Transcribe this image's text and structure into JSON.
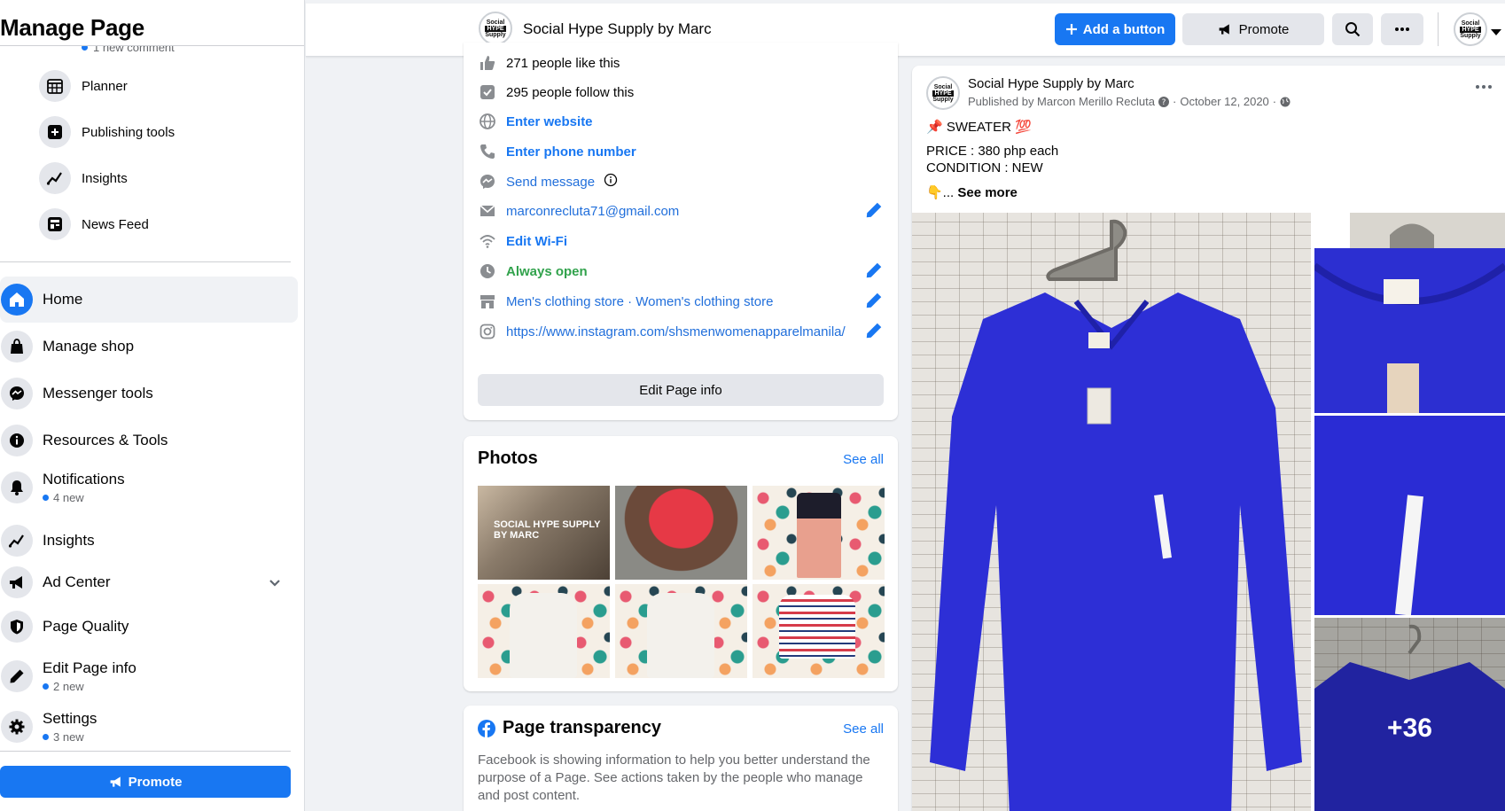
{
  "sidebar": {
    "title": "Manage Page",
    "partial_sub": "1 new comment",
    "tools": [
      {
        "label": "Planner",
        "icon": "calendar-icon"
      },
      {
        "label": "Publishing tools",
        "icon": "publishing-icon"
      },
      {
        "label": "Insights",
        "icon": "insights-icon"
      },
      {
        "label": "News Feed",
        "icon": "news-feed-icon"
      }
    ],
    "nav": [
      {
        "label": "Home",
        "sub": "",
        "icon": "home-icon"
      },
      {
        "label": "Manage shop",
        "sub": "",
        "icon": "shop-bag-icon"
      },
      {
        "label": "Messenger tools",
        "sub": "",
        "icon": "messenger-icon"
      },
      {
        "label": "Resources & Tools",
        "sub": "",
        "icon": "info-icon"
      },
      {
        "label": "Notifications",
        "sub": "4 new",
        "icon": "bell-icon"
      },
      {
        "label": "Insights",
        "sub": "",
        "icon": "insights-icon"
      },
      {
        "label": "Ad Center",
        "sub": "",
        "icon": "megaphone-icon"
      },
      {
        "label": "Page Quality",
        "sub": "",
        "icon": "shield-icon"
      },
      {
        "label": "Edit Page info",
        "sub": "2 new",
        "icon": "pencil-icon"
      },
      {
        "label": "Settings",
        "sub": "3 new",
        "icon": "gear-icon"
      }
    ],
    "promote_label": "Promote"
  },
  "topbar": {
    "page_name": "Social Hype Supply by Marc",
    "add_button_label": "Add a button",
    "promote_label": "Promote"
  },
  "logo": {
    "l1": "Social",
    "l2": "HYPE",
    "l3": "Supply"
  },
  "about": {
    "likes": "271 people like this",
    "follows": "295 people follow this",
    "website": "Enter website",
    "phone": "Enter phone number",
    "message": "Send message",
    "email": "marconrecluta71@gmail.com",
    "wifi": "Edit Wi-Fi",
    "hours": "Always open",
    "category": "Men's clothing store · Women's clothing store",
    "instagram": "https://www.instagram.com/shsmenwomenapparelmanila/",
    "edit_button": "Edit Page info"
  },
  "photos": {
    "title": "Photos",
    "see_all": "See all",
    "photo1_text": "SOCIAL HYPE SUPPLY BY MARC"
  },
  "transparency": {
    "title": "Page transparency",
    "see_all": "See all",
    "body": "Facebook is showing information to help you better understand the purpose of a Page. See actions taken by the people who manage and post content."
  },
  "post": {
    "author": "Social Hype Supply by Marc",
    "published_by": "Published by Marcon Merillo Recluta",
    "date": "October 12, 2020",
    "line1": "📌 SWEATER 💯",
    "line2": "PRICE : 380 php each",
    "line3": "CONDITION : NEW",
    "see_more": "See more",
    "see_more_prefix": "👇... ",
    "more_count": "+36"
  },
  "colors": {
    "accent": "#1877f2",
    "green": "#31a24c",
    "sweater_blue": "#2d2fd6"
  }
}
